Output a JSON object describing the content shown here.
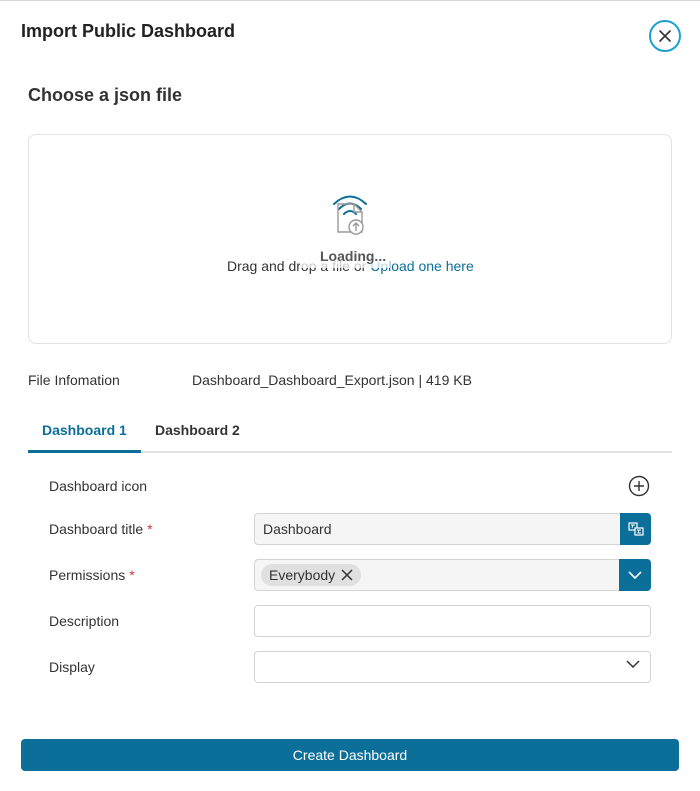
{
  "dialog": {
    "title": "Import Public Dashboard",
    "close_icon": "close-icon"
  },
  "upload": {
    "section_title": "Choose a json file",
    "icon": "file-upload-icon",
    "drag_text": "Drag and drop a file or ",
    "upload_link": "Upload one here",
    "loading_text": "Loading..."
  },
  "file_info": {
    "label": "File Infomation",
    "value": "Dashboard_Dashboard_Export.json | 419 KB"
  },
  "tabs": [
    {
      "label": "Dashboard 1",
      "active": true
    },
    {
      "label": "Dashboard 2",
      "active": false
    }
  ],
  "form": {
    "icon_label": "Dashboard icon",
    "title_label": "Dashboard title",
    "title_value": "Dashboard",
    "permissions_label": "Permissions",
    "permission_chip": "Everybody",
    "description_label": "Description",
    "description_value": "",
    "display_label": "Display",
    "display_value": "",
    "required_mark": "*"
  },
  "footer": {
    "create_label": "Create Dashboard"
  },
  "colors": {
    "primary": "#0b6f99",
    "close_ring": "#1ba0cf",
    "required": "#d23a3a"
  }
}
